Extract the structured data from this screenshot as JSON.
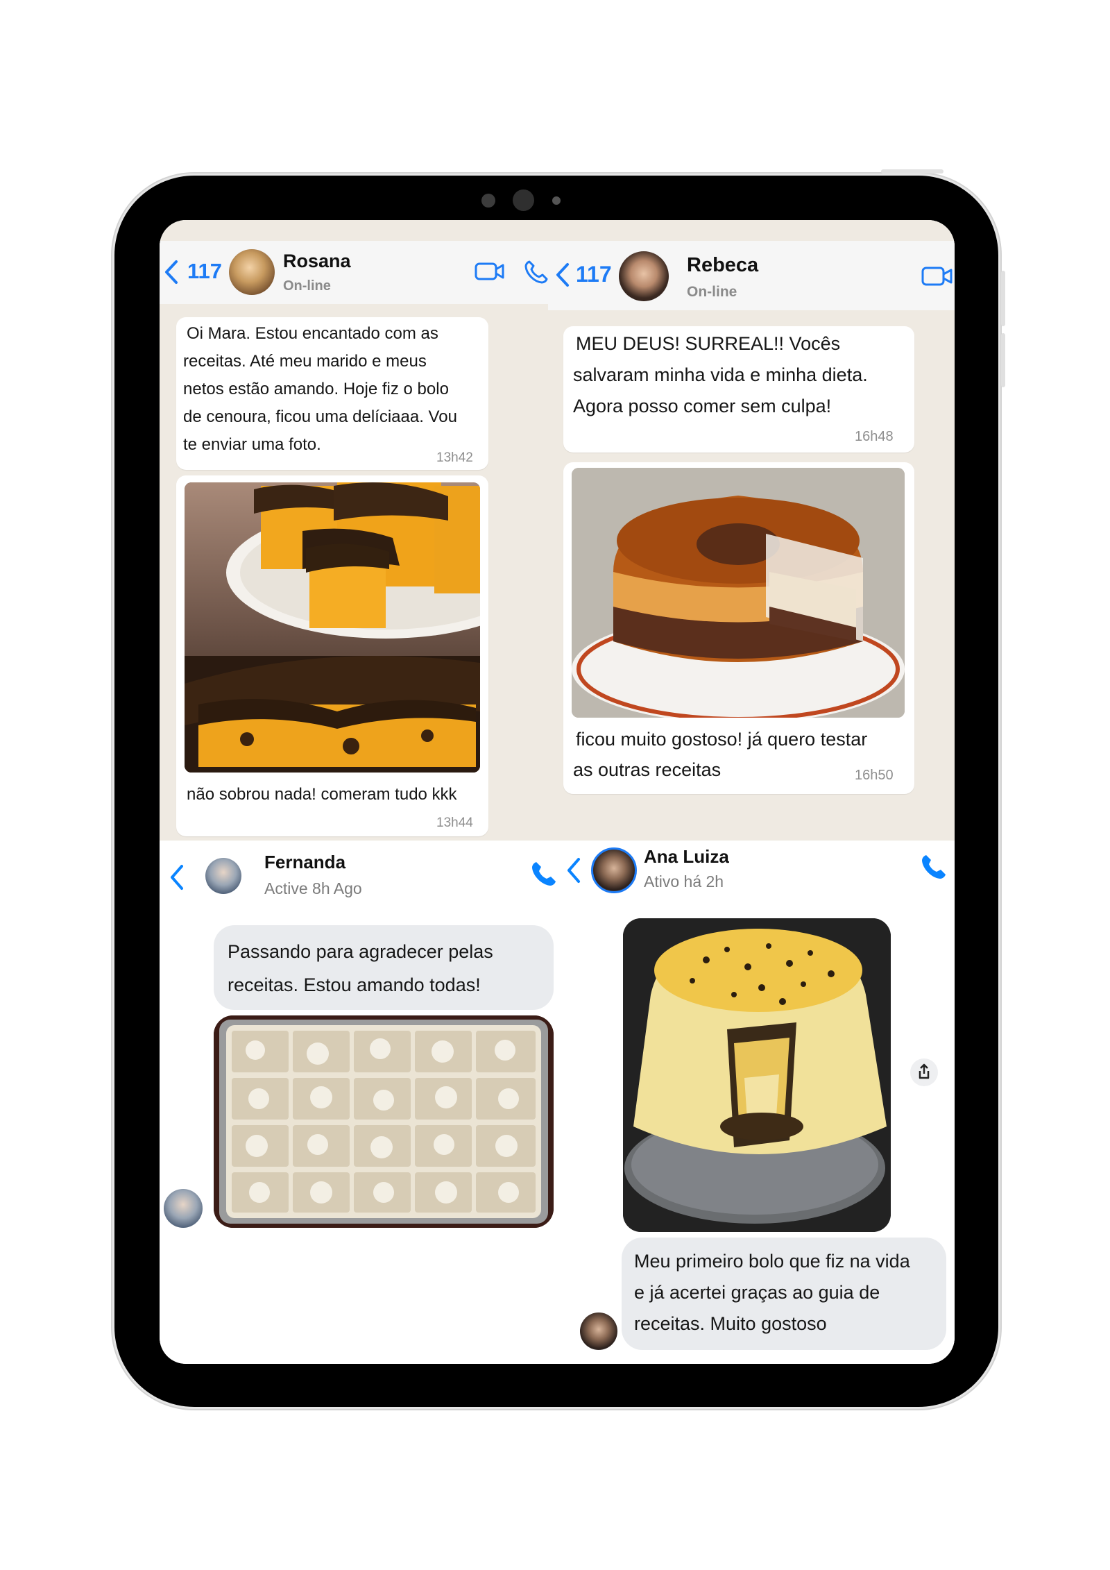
{
  "rosana": {
    "back_count": "117",
    "name": "Rosana",
    "status": "On-line",
    "msg1": [
      "Oi Mara. Estou encantado com as",
      "receitas. Até meu marido e meus",
      "netos estão amando. Hoje fiz o bolo",
      "de cenoura, ficou uma delíciaaa. Vou",
      "te enviar uma foto."
    ],
    "msg1_time": "13h42",
    "msg2": "não sobrou nada! comeram tudo kkk",
    "msg2_time": "13h44"
  },
  "rebeca": {
    "back_count": "117",
    "name": "Rebeca",
    "status": "On-line",
    "msg1": [
      "MEU DEUS! SURREAL!! Vocês",
      "salvaram minha vida e minha dieta.",
      "Agora posso comer sem culpa!"
    ],
    "msg1_time": "16h48",
    "msg2": [
      "ficou muito gostoso! já quero testar",
      "as outras receitas"
    ],
    "msg2_time": "16h50"
  },
  "fernanda": {
    "name": "Fernanda",
    "status": "Active 8h Ago",
    "msg1": [
      "Passando para agradecer pelas",
      "receitas. Estou amando todas!"
    ]
  },
  "ana_luiza": {
    "name": "Ana Luiza",
    "status": "Ativo há 2h",
    "msg1": [
      "Meu primeiro bolo que fiz na vida",
      "e já acertei graças ao guia de",
      "receitas. Muito gostoso"
    ]
  },
  "colors": {
    "ios_blue": "#1d7bf5",
    "messenger_blue": "#0a84ff",
    "wa_background": "#efeae2",
    "messenger_bubble": "#e9ebee"
  },
  "icons": [
    "chevron-left-icon",
    "video-call-icon",
    "phone-icon",
    "share-icon"
  ]
}
